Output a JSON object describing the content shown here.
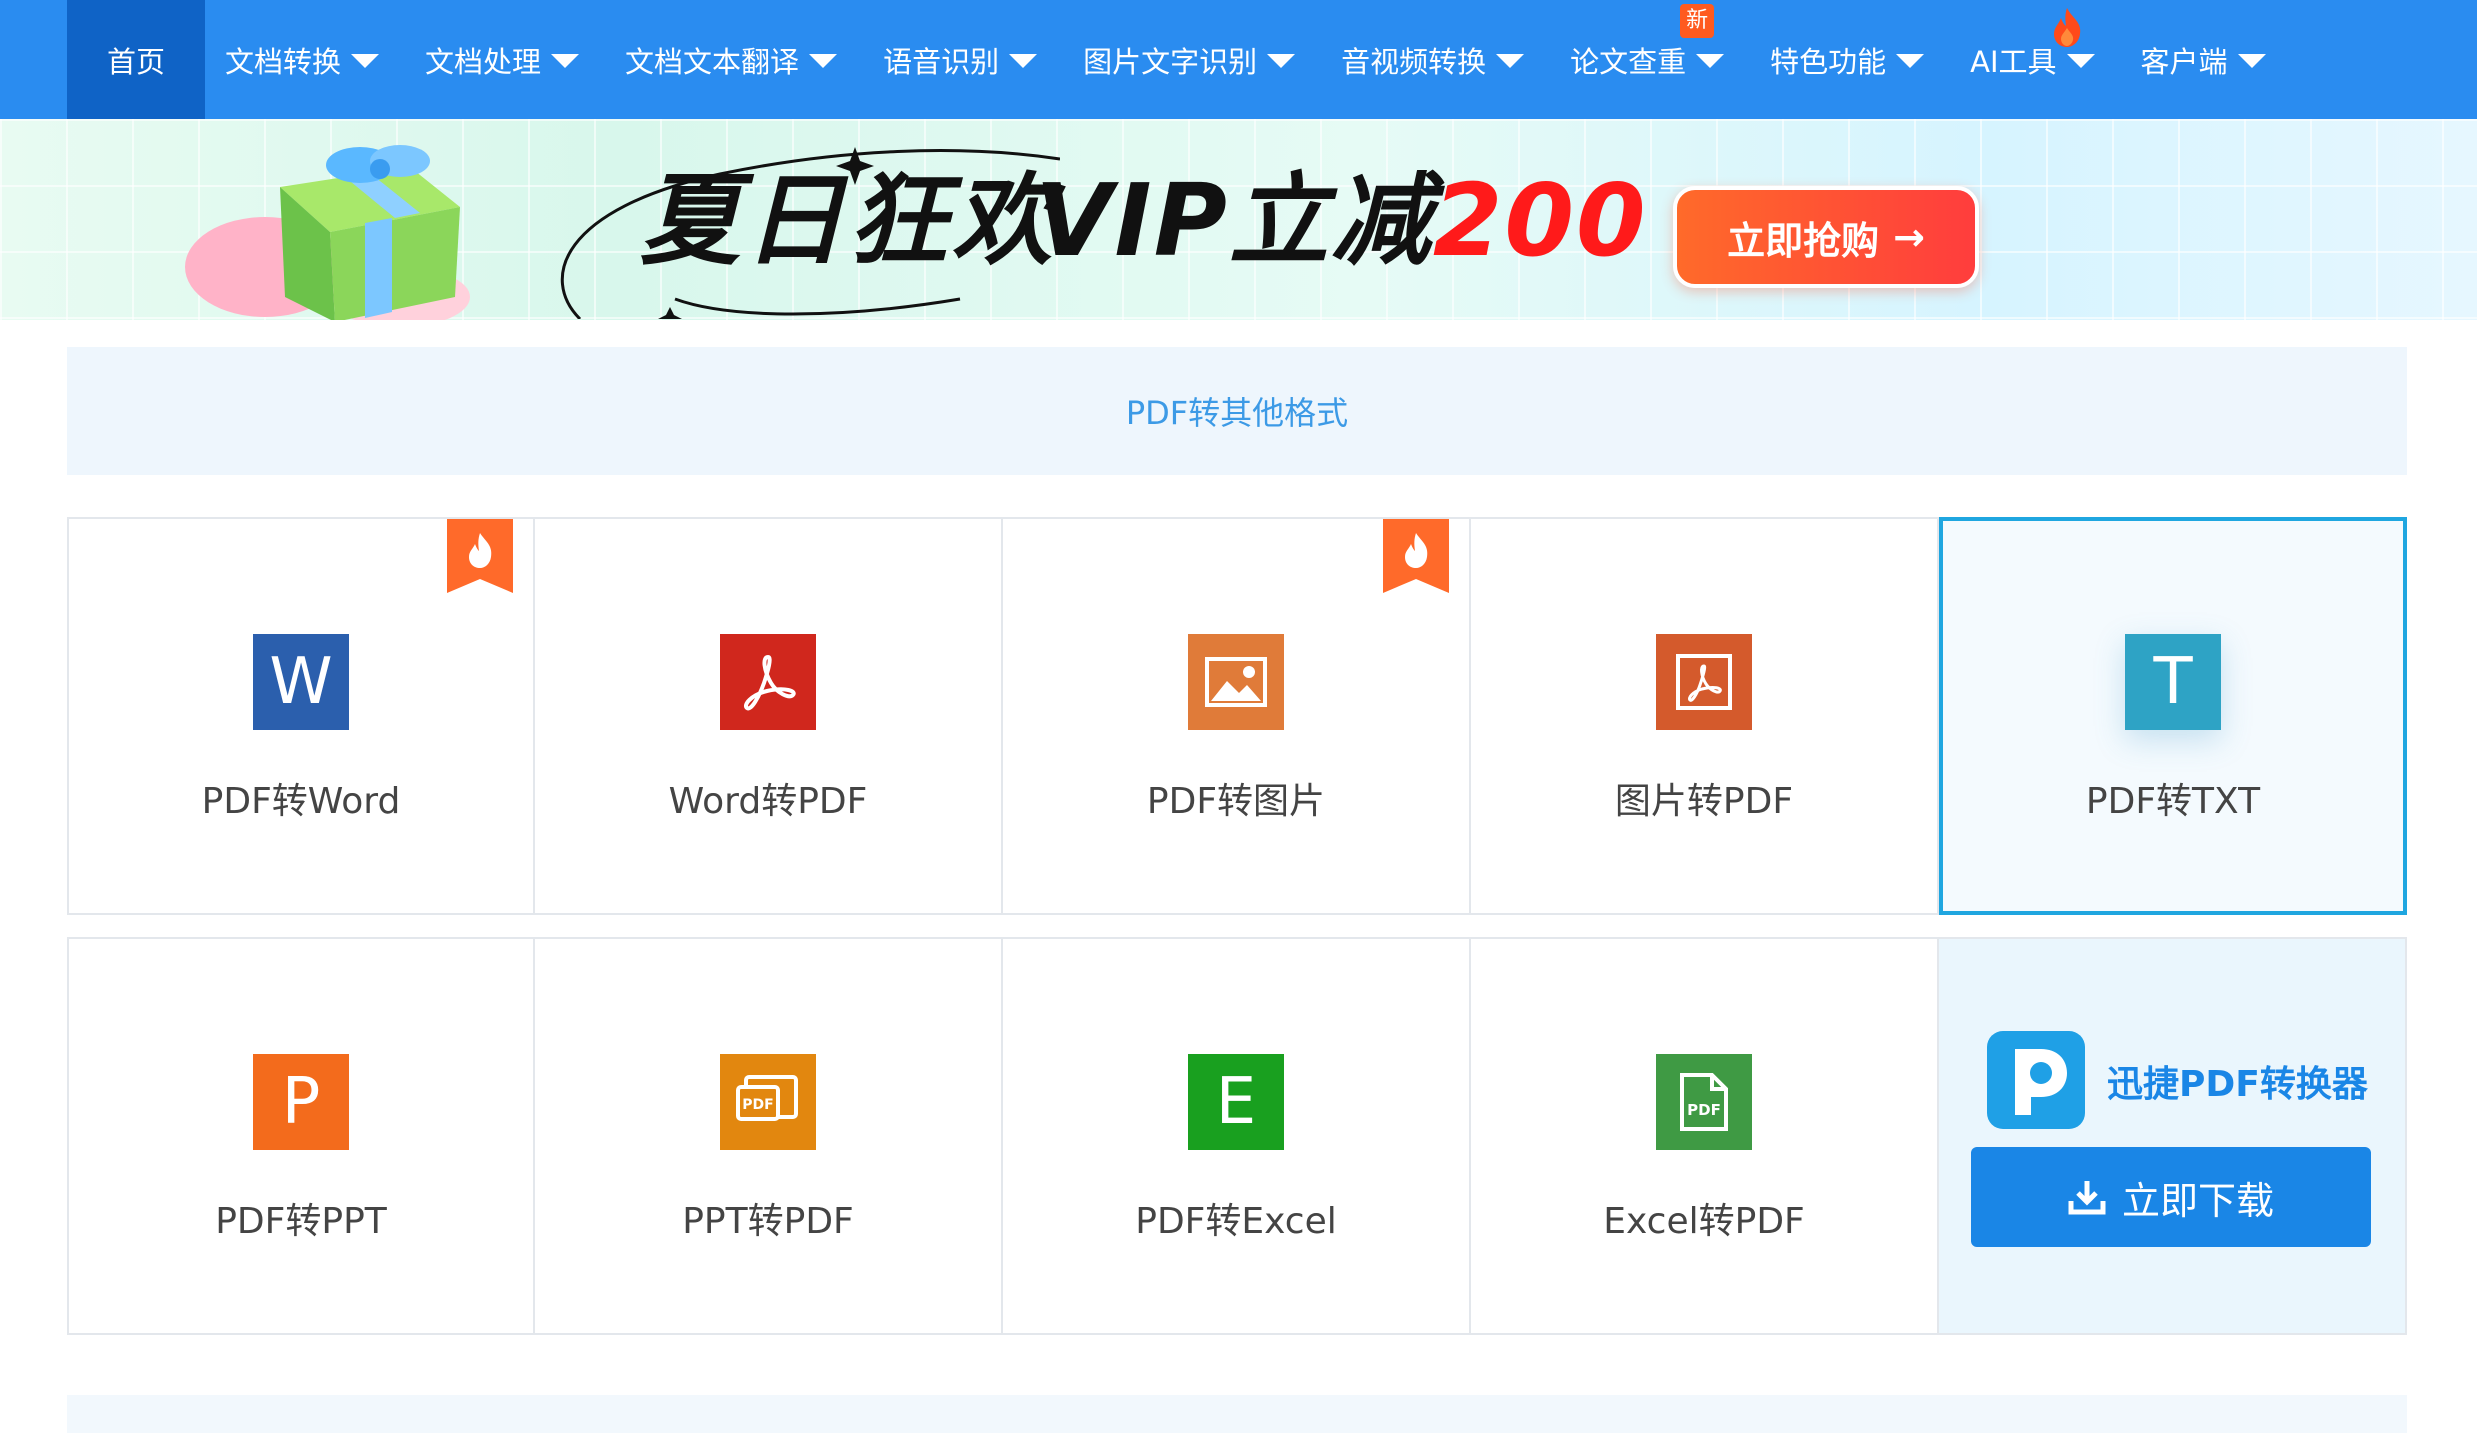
{
  "nav": {
    "items": [
      {
        "label": "首页",
        "active": true,
        "caret": false
      },
      {
        "label": "文档转换",
        "caret": true
      },
      {
        "label": "文档处理",
        "caret": true
      },
      {
        "label": "文档文本翻译",
        "caret": true
      },
      {
        "label": "语音识别",
        "caret": true
      },
      {
        "label": "图片文字识别",
        "caret": true
      },
      {
        "label": "音视频转换",
        "caret": true
      },
      {
        "label": "论文查重",
        "caret": true,
        "badge": "新"
      },
      {
        "label": "特色功能",
        "caret": true
      },
      {
        "label": "AI工具",
        "caret": true,
        "fire": true
      },
      {
        "label": "客户端",
        "caret": true
      }
    ]
  },
  "banner": {
    "headline": "夏日狂欢",
    "vip_text": "VIP立减",
    "vip_amount": "200",
    "buy_label": "立即抢购",
    "buy_arrow": "→"
  },
  "section": {
    "title": "PDF转其他格式"
  },
  "tools_row1": [
    {
      "label": "PDF转Word",
      "icon": "word-icon",
      "color": "#2b5fad",
      "letter": "W",
      "hot": true
    },
    {
      "label": "Word转PDF",
      "icon": "acrobat-icon",
      "color": "#d0271d",
      "hot": false
    },
    {
      "label": "PDF转图片",
      "icon": "image-icon",
      "color": "#e07b39",
      "hot": true
    },
    {
      "label": "图片转PDF",
      "icon": "pdf-image-icon",
      "color": "#d45a2c",
      "hot": false
    },
    {
      "label": "PDF转TXT",
      "icon": "text-icon",
      "color": "#2ea3c5",
      "letter": "T",
      "hot": false,
      "selected": true
    }
  ],
  "tools_row2": [
    {
      "label": "PDF转PPT",
      "icon": "powerpoint-icon",
      "color": "#f36b1c",
      "letter": "P"
    },
    {
      "label": "PPT转PDF",
      "icon": "ppt-pdf-icon",
      "color": "#e2870f"
    },
    {
      "label": "PDF转Excel",
      "icon": "excel-icon",
      "color": "#19a01f",
      "letter": "E"
    },
    {
      "label": "Excel转PDF",
      "icon": "excel-pdf-icon",
      "color": "#3f9a44"
    }
  ],
  "promo": {
    "title": "迅捷PDF转换器",
    "download_label": "立即下载"
  },
  "colors": {
    "nav_bg": "#2a8cf0",
    "nav_active": "#0f63c6",
    "accent": "#1a86e6",
    "selected_border": "#1fa6e0"
  }
}
